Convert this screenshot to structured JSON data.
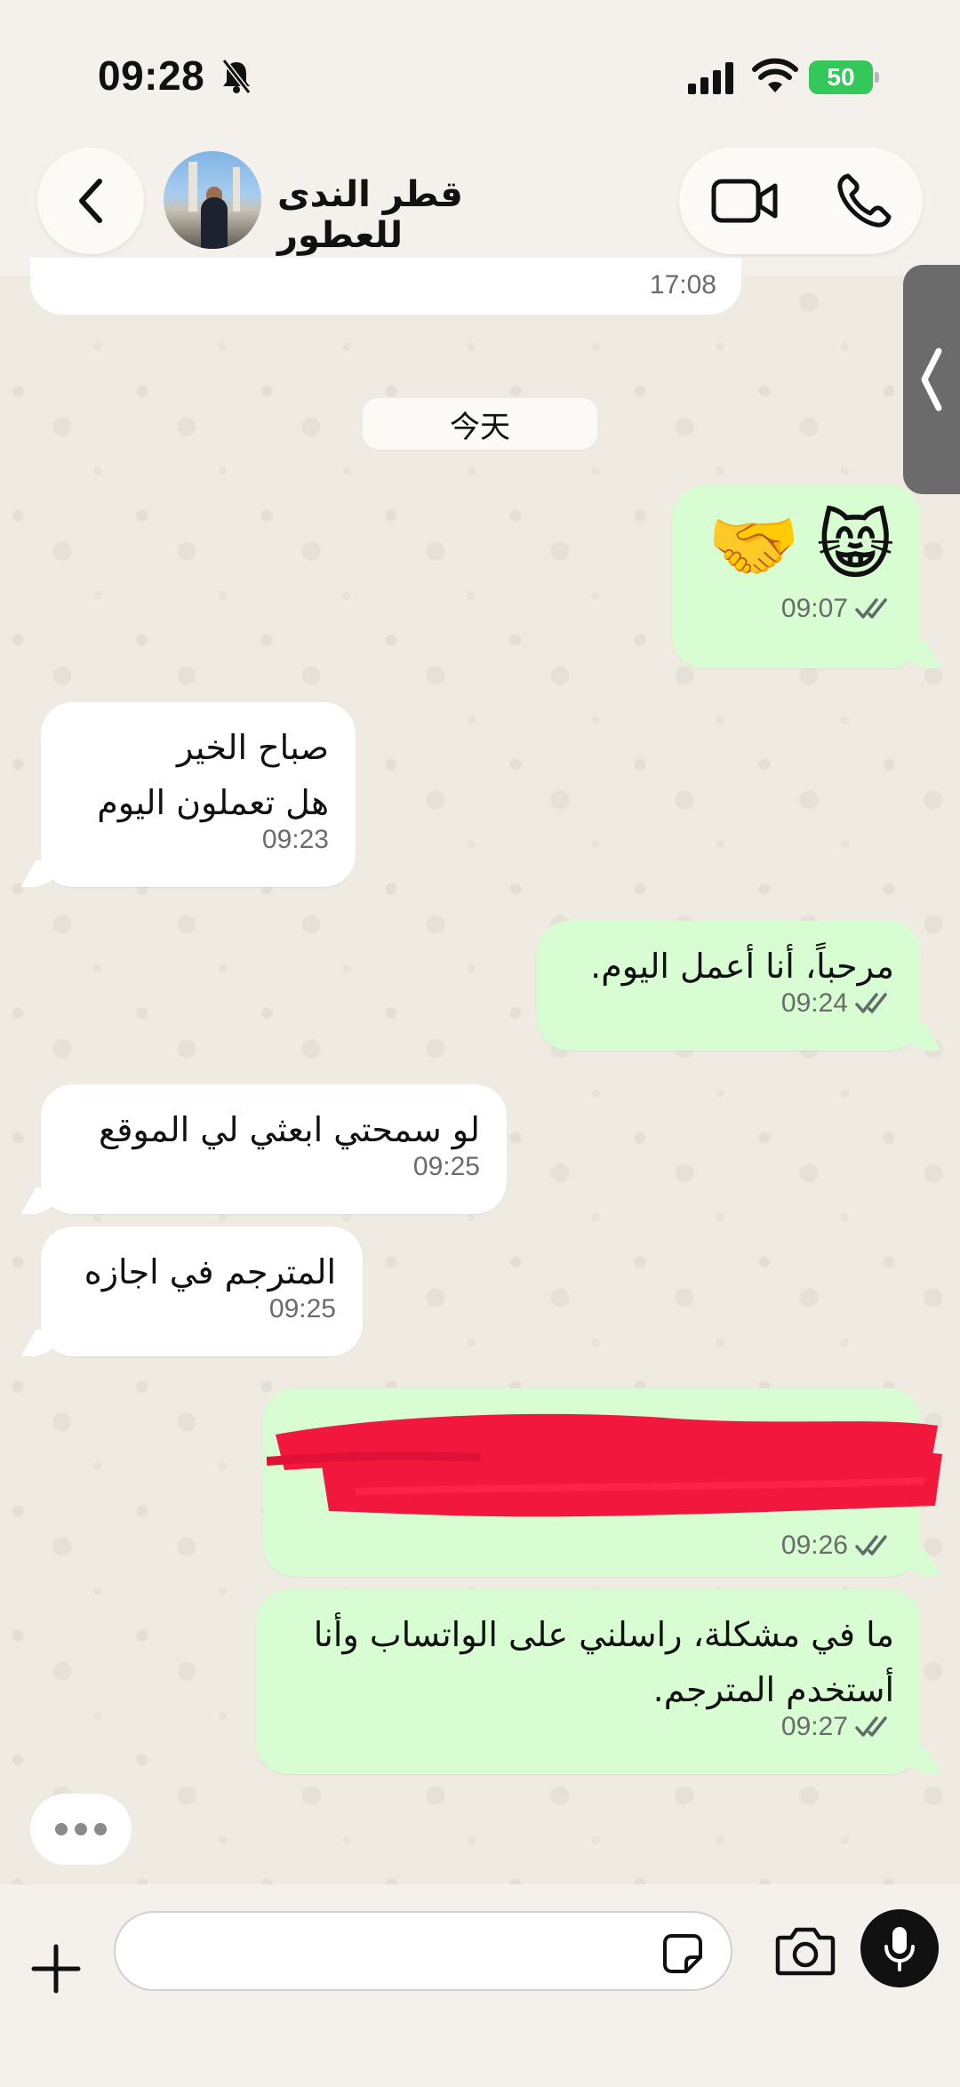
{
  "status_bar": {
    "time": "09:28",
    "battery": "50"
  },
  "header": {
    "contact_name": "قطر الندى للعطور"
  },
  "chat": {
    "previous_message_time": "17:08",
    "date_separator": "今天",
    "messages": [
      {
        "direction": "outgoing",
        "emoji": [
          "🤝",
          "😸"
        ],
        "time": "09:07"
      },
      {
        "direction": "incoming",
        "text": "صباح الخير\nهل تعملون اليوم",
        "time": "09:23"
      },
      {
        "direction": "outgoing",
        "text": "مرحباً، أنا أعمل اليوم.",
        "time": "09:24"
      },
      {
        "direction": "incoming",
        "text": "لو سمحتي ابعثي لي الموقع",
        "time": "09:25"
      },
      {
        "direction": "incoming",
        "text": "المترجم في اجازه",
        "time": "09:25"
      },
      {
        "direction": "outgoing",
        "redacted": true,
        "time": "09:26"
      },
      {
        "direction": "outgoing",
        "text": "ما في مشكلة، راسلني على الواتساب وأنا\nأستخدم المترجم.",
        "time": "09:27"
      }
    ]
  },
  "input": {
    "placeholder": ""
  },
  "icons": {
    "back": "chevron-left-icon",
    "video": "video-call-icon",
    "phone": "phone-icon",
    "plus": "plus-icon",
    "sticker": "sticker-icon",
    "camera": "camera-icon",
    "mic": "microphone-icon",
    "ticks": "double-check-icon"
  },
  "colors": {
    "outgoing_bubble": "#d8fdd2",
    "incoming_bubble": "#ffffff",
    "read_ticks": "#5f6b6b",
    "battery": "#34c759"
  }
}
